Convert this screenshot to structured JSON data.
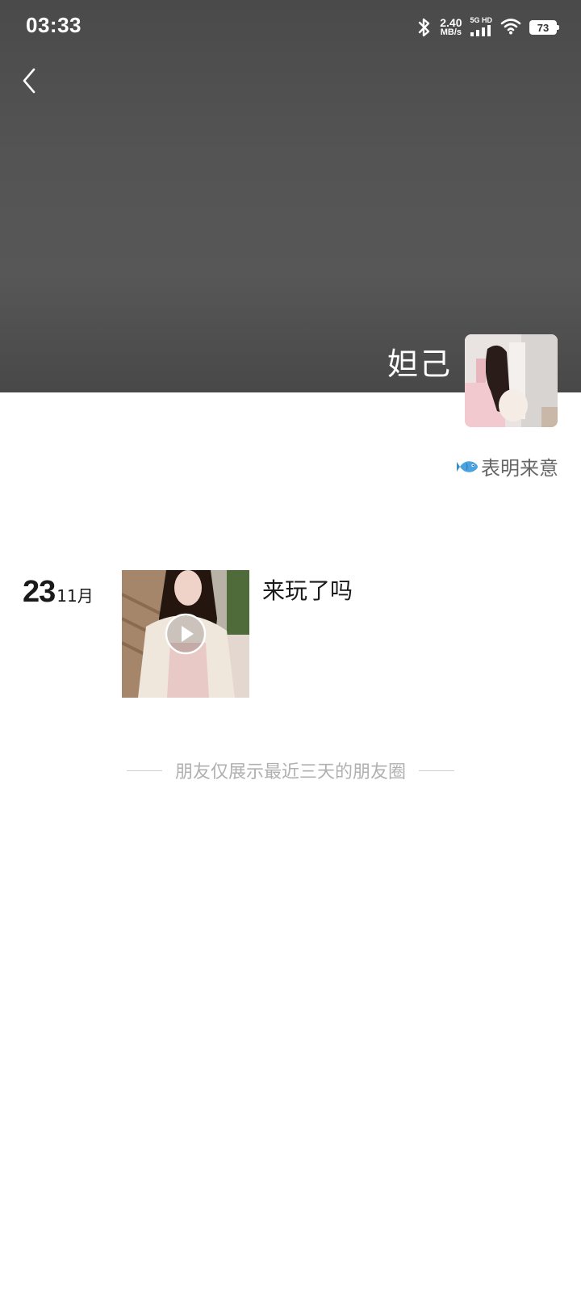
{
  "status_bar": {
    "time": "03:33",
    "net_speed_value": "2.40",
    "net_speed_unit": "MB/s",
    "network_tag": "5G HD",
    "battery": "73",
    "icons": [
      "bluetooth-icon",
      "signal-icon",
      "wifi-icon",
      "battery-icon"
    ]
  },
  "header": {
    "back_icon": "chevron-left-icon",
    "profile_name": "妲己"
  },
  "profile": {
    "intent_label": "表明来意",
    "intent_icon": "fish-icon"
  },
  "posts": [
    {
      "day": "23",
      "month": "11月",
      "text": "来玩了吗",
      "media": "video",
      "media_icon": "play-icon"
    }
  ],
  "footer": {
    "notice": "朋友仅展示最近三天的朋友圈"
  },
  "colors": {
    "cover_bg": "#555555",
    "text_primary": "#1a1a1a",
    "text_secondary": "#666666",
    "notice_text": "#b0b0b0"
  }
}
